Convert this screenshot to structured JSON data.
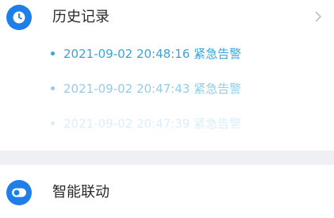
{
  "history": {
    "title": "历史记录",
    "icon": "clock-icon",
    "chevron": "chevron-right-icon",
    "records": [
      {
        "text": "2021-09-02 20:48:16 紧急告警"
      },
      {
        "text": "2021-09-02 20:47:43 紧急告警"
      },
      {
        "text": "2021-09-02 20:47:39 紧急告警"
      }
    ]
  },
  "linkage": {
    "title": "智能联动",
    "icon": "toggle-icon"
  },
  "colors": {
    "accent": "#1e7fe8",
    "record_text": "#38a4dc",
    "divider": "#eef0f3",
    "title_text": "#2a2a2a",
    "chevron": "#b8b8b8"
  }
}
